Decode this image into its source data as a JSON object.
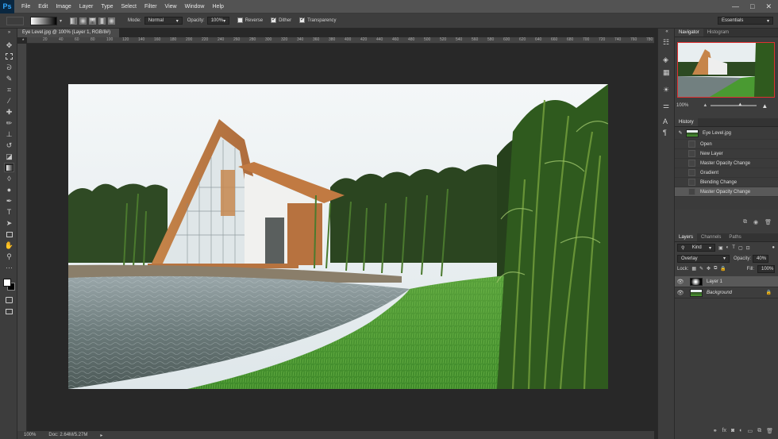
{
  "app": {
    "logo": "Ps"
  },
  "menu": [
    "File",
    "Edit",
    "Image",
    "Layer",
    "Type",
    "Select",
    "Filter",
    "View",
    "Window",
    "Help"
  ],
  "window_controls": {
    "minimize": "—",
    "maximize": "□",
    "close": "✕"
  },
  "options": {
    "mode_label": "Mode:",
    "mode_value": "Normal",
    "opacity_label": "Opacity:",
    "opacity_value": "100%",
    "reverse": "Reverse",
    "dither": "Dither",
    "transparency": "Transparency",
    "workspace": "Essentials"
  },
  "document": {
    "tab_title": "Eye Level.jpg @ 100% (Layer 1, RGB/8#) *",
    "zoom": "100%",
    "doc_info": "Doc: 2.64M/5.27M"
  },
  "ruler_ticks": [
    "20",
    "40",
    "60",
    "80",
    "100",
    "120",
    "140",
    "160",
    "180",
    "200",
    "220",
    "240",
    "260",
    "280",
    "300",
    "320",
    "340",
    "360",
    "380",
    "400",
    "420",
    "440",
    "460",
    "480",
    "500",
    "520",
    "540",
    "560",
    "580",
    "600",
    "620",
    "640",
    "660",
    "680",
    "700",
    "720",
    "740",
    "760",
    "780"
  ],
  "navigator": {
    "tabs": [
      "Navigator",
      "Histogram"
    ],
    "zoom": "100%"
  },
  "history": {
    "title": "History",
    "snapshot": "Eye Level.jpg",
    "items": [
      "Open",
      "New Layer",
      "Master Opacity Change",
      "Gradient",
      "Blending Change",
      "Master Opacity Change"
    ]
  },
  "layers_panel": {
    "tabs": [
      "Layers",
      "Channels",
      "Paths"
    ],
    "filter": "Kind",
    "blend_mode": "Overlay",
    "opacity_label": "Opacity:",
    "opacity_value": "40%",
    "lock_label": "Lock:",
    "fill_label": "Fill:",
    "fill_value": "100%",
    "layers": [
      {
        "name": "Layer 1"
      },
      {
        "name": "Background"
      }
    ]
  },
  "colors": {
    "accent": "#31a8ff",
    "panel": "#3d3d3d",
    "canvas_bg": "#282828",
    "nav_frame": "#e03131"
  }
}
